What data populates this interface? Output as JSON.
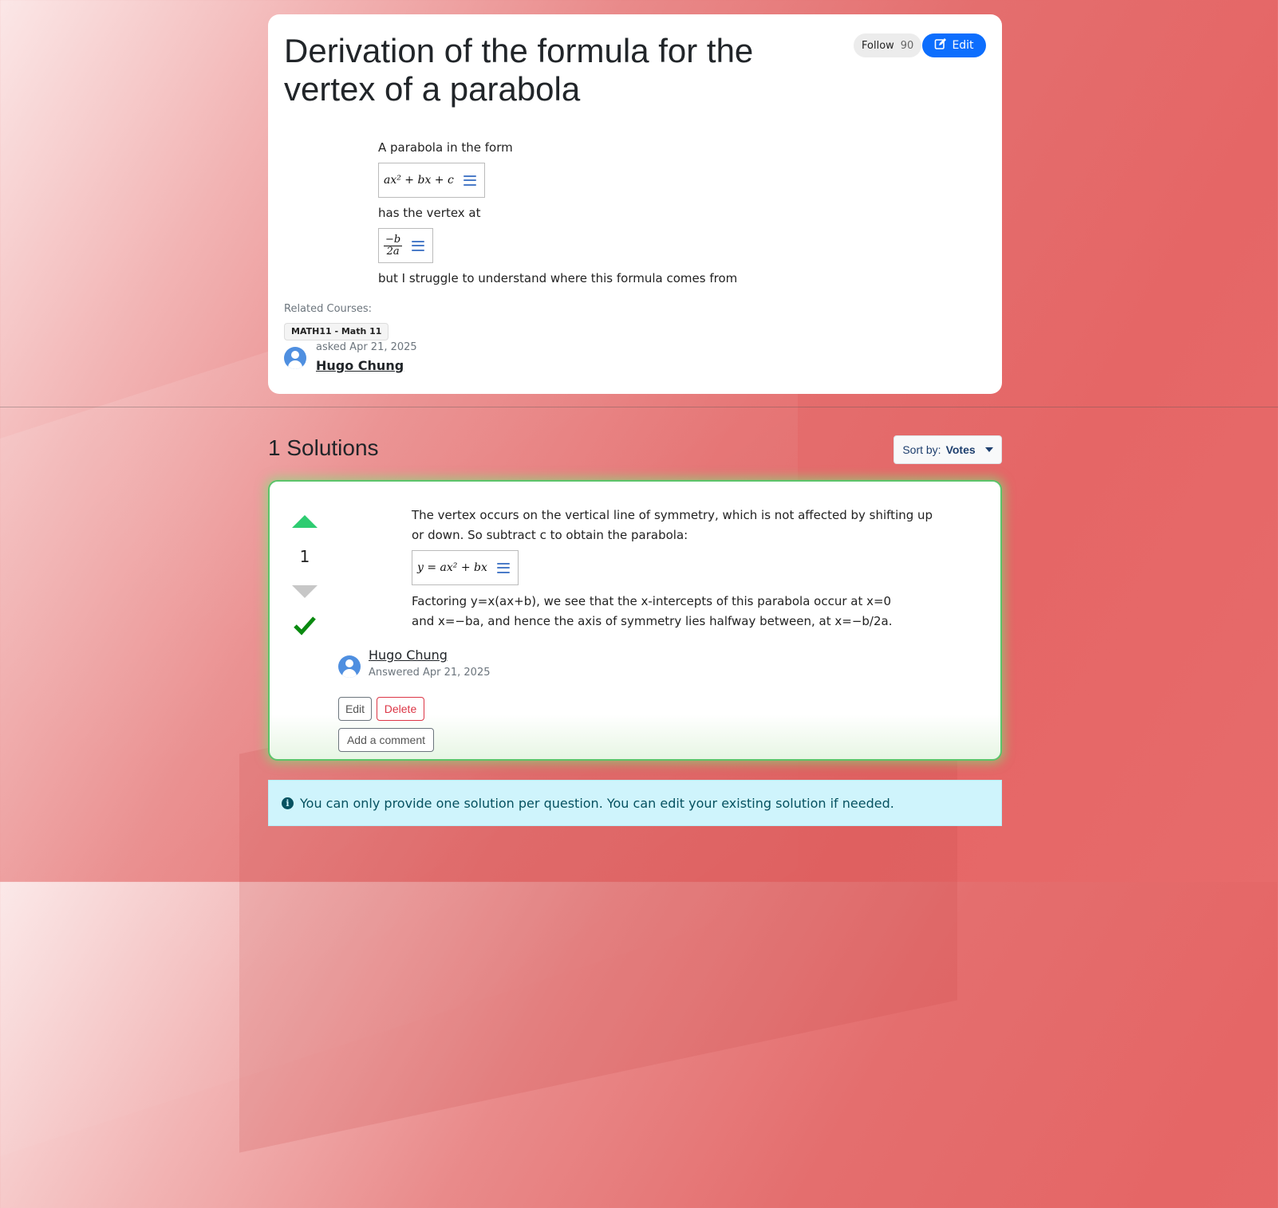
{
  "question": {
    "title": "Derivation of the formula for the vertex of a parabola",
    "follow_label": "Follow",
    "follow_count": "90",
    "edit_label": "Edit",
    "body": {
      "line1": "A parabola in the form",
      "math1": "ax² + bx + c",
      "line2": "has the vertex at",
      "math2_num": "−b",
      "math2_den": "2a",
      "line3": "but I struggle to understand where this formula comes from"
    },
    "related_label": "Related Courses:",
    "course": "MATH11 - Math 11",
    "asked": "asked Apr 21, 2025",
    "author": "Hugo Chung"
  },
  "solutions": {
    "title": "1 Solutions",
    "sort_prefix": "Sort by:",
    "sort_value": "Votes"
  },
  "answer": {
    "votes": "1",
    "para1": "The vertex occurs on the vertical line of symmetry, which is not affected by shifting up or down. So subtract c to obtain the parabola:",
    "math": "y = ax² + bx",
    "para2": "Factoring y=x(ax+b), we see that the x-intercepts of this parabola occur at x=0 and x=−ba, and hence the axis of symmetry lies halfway between, at x=−b/2a.",
    "author": "Hugo Chung",
    "answered": "Answered Apr 21, 2025",
    "edit_label": "Edit",
    "delete_label": "Delete",
    "comment_label": "Add a comment"
  },
  "alert": {
    "text": "You can only provide one solution per question. You can edit your existing solution if needed."
  },
  "colors": {
    "primary": "#0d6efd",
    "accepted": "#5cc46a",
    "upvote": "#2ecc71",
    "danger": "#dc3545",
    "info_bg": "#cff4fc"
  }
}
